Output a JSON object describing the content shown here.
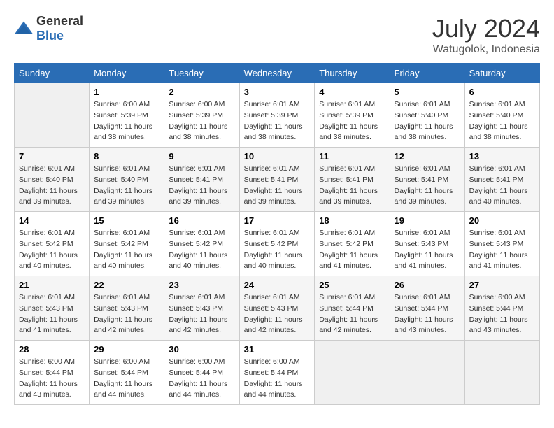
{
  "header": {
    "logo_general": "General",
    "logo_blue": "Blue",
    "month_year": "July 2024",
    "location": "Watugolok, Indonesia"
  },
  "days_of_week": [
    "Sunday",
    "Monday",
    "Tuesday",
    "Wednesday",
    "Thursday",
    "Friday",
    "Saturday"
  ],
  "weeks": [
    [
      {
        "day": "",
        "sunrise": "",
        "sunset": "",
        "daylight": ""
      },
      {
        "day": "1",
        "sunrise": "Sunrise: 6:00 AM",
        "sunset": "Sunset: 5:39 PM",
        "daylight": "Daylight: 11 hours and 38 minutes."
      },
      {
        "day": "2",
        "sunrise": "Sunrise: 6:00 AM",
        "sunset": "Sunset: 5:39 PM",
        "daylight": "Daylight: 11 hours and 38 minutes."
      },
      {
        "day": "3",
        "sunrise": "Sunrise: 6:01 AM",
        "sunset": "Sunset: 5:39 PM",
        "daylight": "Daylight: 11 hours and 38 minutes."
      },
      {
        "day": "4",
        "sunrise": "Sunrise: 6:01 AM",
        "sunset": "Sunset: 5:39 PM",
        "daylight": "Daylight: 11 hours and 38 minutes."
      },
      {
        "day": "5",
        "sunrise": "Sunrise: 6:01 AM",
        "sunset": "Sunset: 5:40 PM",
        "daylight": "Daylight: 11 hours and 38 minutes."
      },
      {
        "day": "6",
        "sunrise": "Sunrise: 6:01 AM",
        "sunset": "Sunset: 5:40 PM",
        "daylight": "Daylight: 11 hours and 38 minutes."
      }
    ],
    [
      {
        "day": "7",
        "sunrise": "Sunrise: 6:01 AM",
        "sunset": "Sunset: 5:40 PM",
        "daylight": "Daylight: 11 hours and 39 minutes."
      },
      {
        "day": "8",
        "sunrise": "Sunrise: 6:01 AM",
        "sunset": "Sunset: 5:40 PM",
        "daylight": "Daylight: 11 hours and 39 minutes."
      },
      {
        "day": "9",
        "sunrise": "Sunrise: 6:01 AM",
        "sunset": "Sunset: 5:41 PM",
        "daylight": "Daylight: 11 hours and 39 minutes."
      },
      {
        "day": "10",
        "sunrise": "Sunrise: 6:01 AM",
        "sunset": "Sunset: 5:41 PM",
        "daylight": "Daylight: 11 hours and 39 minutes."
      },
      {
        "day": "11",
        "sunrise": "Sunrise: 6:01 AM",
        "sunset": "Sunset: 5:41 PM",
        "daylight": "Daylight: 11 hours and 39 minutes."
      },
      {
        "day": "12",
        "sunrise": "Sunrise: 6:01 AM",
        "sunset": "Sunset: 5:41 PM",
        "daylight": "Daylight: 11 hours and 39 minutes."
      },
      {
        "day": "13",
        "sunrise": "Sunrise: 6:01 AM",
        "sunset": "Sunset: 5:41 PM",
        "daylight": "Daylight: 11 hours and 40 minutes."
      }
    ],
    [
      {
        "day": "14",
        "sunrise": "Sunrise: 6:01 AM",
        "sunset": "Sunset: 5:42 PM",
        "daylight": "Daylight: 11 hours and 40 minutes."
      },
      {
        "day": "15",
        "sunrise": "Sunrise: 6:01 AM",
        "sunset": "Sunset: 5:42 PM",
        "daylight": "Daylight: 11 hours and 40 minutes."
      },
      {
        "day": "16",
        "sunrise": "Sunrise: 6:01 AM",
        "sunset": "Sunset: 5:42 PM",
        "daylight": "Daylight: 11 hours and 40 minutes."
      },
      {
        "day": "17",
        "sunrise": "Sunrise: 6:01 AM",
        "sunset": "Sunset: 5:42 PM",
        "daylight": "Daylight: 11 hours and 40 minutes."
      },
      {
        "day": "18",
        "sunrise": "Sunrise: 6:01 AM",
        "sunset": "Sunset: 5:42 PM",
        "daylight": "Daylight: 11 hours and 41 minutes."
      },
      {
        "day": "19",
        "sunrise": "Sunrise: 6:01 AM",
        "sunset": "Sunset: 5:43 PM",
        "daylight": "Daylight: 11 hours and 41 minutes."
      },
      {
        "day": "20",
        "sunrise": "Sunrise: 6:01 AM",
        "sunset": "Sunset: 5:43 PM",
        "daylight": "Daylight: 11 hours and 41 minutes."
      }
    ],
    [
      {
        "day": "21",
        "sunrise": "Sunrise: 6:01 AM",
        "sunset": "Sunset: 5:43 PM",
        "daylight": "Daylight: 11 hours and 41 minutes."
      },
      {
        "day": "22",
        "sunrise": "Sunrise: 6:01 AM",
        "sunset": "Sunset: 5:43 PM",
        "daylight": "Daylight: 11 hours and 42 minutes."
      },
      {
        "day": "23",
        "sunrise": "Sunrise: 6:01 AM",
        "sunset": "Sunset: 5:43 PM",
        "daylight": "Daylight: 11 hours and 42 minutes."
      },
      {
        "day": "24",
        "sunrise": "Sunrise: 6:01 AM",
        "sunset": "Sunset: 5:43 PM",
        "daylight": "Daylight: 11 hours and 42 minutes."
      },
      {
        "day": "25",
        "sunrise": "Sunrise: 6:01 AM",
        "sunset": "Sunset: 5:44 PM",
        "daylight": "Daylight: 11 hours and 42 minutes."
      },
      {
        "day": "26",
        "sunrise": "Sunrise: 6:01 AM",
        "sunset": "Sunset: 5:44 PM",
        "daylight": "Daylight: 11 hours and 43 minutes."
      },
      {
        "day": "27",
        "sunrise": "Sunrise: 6:00 AM",
        "sunset": "Sunset: 5:44 PM",
        "daylight": "Daylight: 11 hours and 43 minutes."
      }
    ],
    [
      {
        "day": "28",
        "sunrise": "Sunrise: 6:00 AM",
        "sunset": "Sunset: 5:44 PM",
        "daylight": "Daylight: 11 hours and 43 minutes."
      },
      {
        "day": "29",
        "sunrise": "Sunrise: 6:00 AM",
        "sunset": "Sunset: 5:44 PM",
        "daylight": "Daylight: 11 hours and 44 minutes."
      },
      {
        "day": "30",
        "sunrise": "Sunrise: 6:00 AM",
        "sunset": "Sunset: 5:44 PM",
        "daylight": "Daylight: 11 hours and 44 minutes."
      },
      {
        "day": "31",
        "sunrise": "Sunrise: 6:00 AM",
        "sunset": "Sunset: 5:44 PM",
        "daylight": "Daylight: 11 hours and 44 minutes."
      },
      {
        "day": "",
        "sunrise": "",
        "sunset": "",
        "daylight": ""
      },
      {
        "day": "",
        "sunrise": "",
        "sunset": "",
        "daylight": ""
      },
      {
        "day": "",
        "sunrise": "",
        "sunset": "",
        "daylight": ""
      }
    ]
  ]
}
